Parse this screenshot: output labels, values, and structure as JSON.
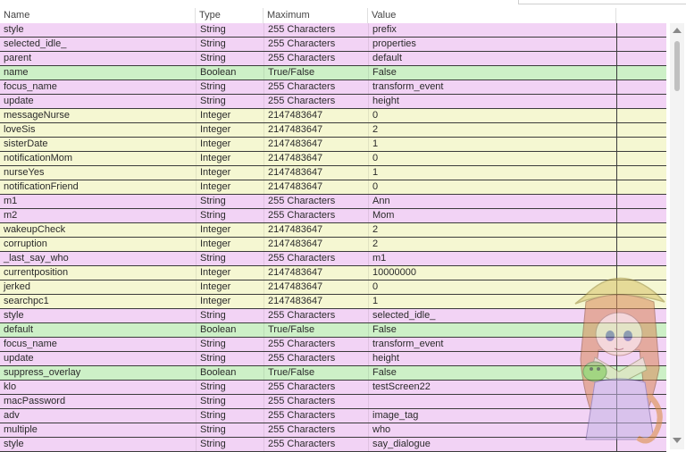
{
  "header": {
    "name": "Name",
    "type": "Type",
    "maximum": "Maximum",
    "value": "Value"
  },
  "rows": [
    {
      "name": "style",
      "type": "String",
      "max": "255 Characters",
      "value": "prefix",
      "kind": "str"
    },
    {
      "name": "selected_idle_",
      "type": "String",
      "max": "255 Characters",
      "value": "properties",
      "kind": "str"
    },
    {
      "name": "parent",
      "type": "String",
      "max": "255 Characters",
      "value": "default",
      "kind": "str"
    },
    {
      "name": "name",
      "type": "Boolean",
      "max": "True/False",
      "value": "False",
      "kind": "bool"
    },
    {
      "name": "focus_name",
      "type": "String",
      "max": "255 Characters",
      "value": "transform_event",
      "kind": "str"
    },
    {
      "name": "update",
      "type": "String",
      "max": "255 Characters",
      "value": "height",
      "kind": "str"
    },
    {
      "name": "messageNurse",
      "type": "Integer",
      "max": "2147483647",
      "value": "0",
      "kind": "int"
    },
    {
      "name": "loveSis",
      "type": "Integer",
      "max": "2147483647",
      "value": "2",
      "kind": "int"
    },
    {
      "name": "sisterDate",
      "type": "Integer",
      "max": "2147483647",
      "value": "1",
      "kind": "int"
    },
    {
      "name": "notificationMom",
      "type": "Integer",
      "max": "2147483647",
      "value": "0",
      "kind": "int"
    },
    {
      "name": "nurseYes",
      "type": "Integer",
      "max": "2147483647",
      "value": "1",
      "kind": "int"
    },
    {
      "name": "notificationFriend",
      "type": "Integer",
      "max": "2147483647",
      "value": "0",
      "kind": "int"
    },
    {
      "name": "m1",
      "type": "String",
      "max": "255 Characters",
      "value": "Ann",
      "kind": "str"
    },
    {
      "name": "m2",
      "type": "String",
      "max": "255 Characters",
      "value": "Mom",
      "kind": "str"
    },
    {
      "name": "wakeupCheck",
      "type": "Integer",
      "max": "2147483647",
      "value": "2",
      "kind": "int"
    },
    {
      "name": "corruption",
      "type": "Integer",
      "max": "2147483647",
      "value": "2",
      "kind": "int"
    },
    {
      "name": "_last_say_who",
      "type": "String",
      "max": "255 Characters",
      "value": "m1",
      "kind": "str"
    },
    {
      "name": "currentposition",
      "type": "Integer",
      "max": "2147483647",
      "value": "10000000",
      "kind": "int"
    },
    {
      "name": "jerked",
      "type": "Integer",
      "max": "2147483647",
      "value": "0",
      "kind": "int"
    },
    {
      "name": "searchpc1",
      "type": "Integer",
      "max": "2147483647",
      "value": "1",
      "kind": "int"
    },
    {
      "name": "style",
      "type": "String",
      "max": "255 Characters",
      "value": "selected_idle_",
      "kind": "str"
    },
    {
      "name": "default",
      "type": "Boolean",
      "max": "True/False",
      "value": "False",
      "kind": "bool"
    },
    {
      "name": "focus_name",
      "type": "String",
      "max": "255 Characters",
      "value": "transform_event",
      "kind": "str"
    },
    {
      "name": "update",
      "type": "String",
      "max": "255 Characters",
      "value": "height",
      "kind": "str"
    },
    {
      "name": "suppress_overlay",
      "type": "Boolean",
      "max": "True/False",
      "value": "False",
      "kind": "bool"
    },
    {
      "name": "klo",
      "type": "String",
      "max": "255 Characters",
      "value": "testScreen22",
      "kind": "str"
    },
    {
      "name": "macPassword",
      "type": "String",
      "max": "255 Characters",
      "value": "",
      "kind": "str"
    },
    {
      "name": "adv",
      "type": "String",
      "max": "255 Characters",
      "value": "image_tag",
      "kind": "str"
    },
    {
      "name": "multiple",
      "type": "String",
      "max": "255 Characters",
      "value": "who",
      "kind": "str"
    },
    {
      "name": "style",
      "type": "String",
      "max": "255 Characters",
      "value": "say_dialogue",
      "kind": "str"
    }
  ],
  "colors": {
    "string_row": "#f2d3f5",
    "integer_row": "#f5f7d2",
    "boolean_row": "#cdf0c7"
  },
  "icons": {
    "scroll_up": "triangle-up-icon",
    "scroll_down": "triangle-down-icon",
    "watermark": "mascot-watermark-icon"
  }
}
